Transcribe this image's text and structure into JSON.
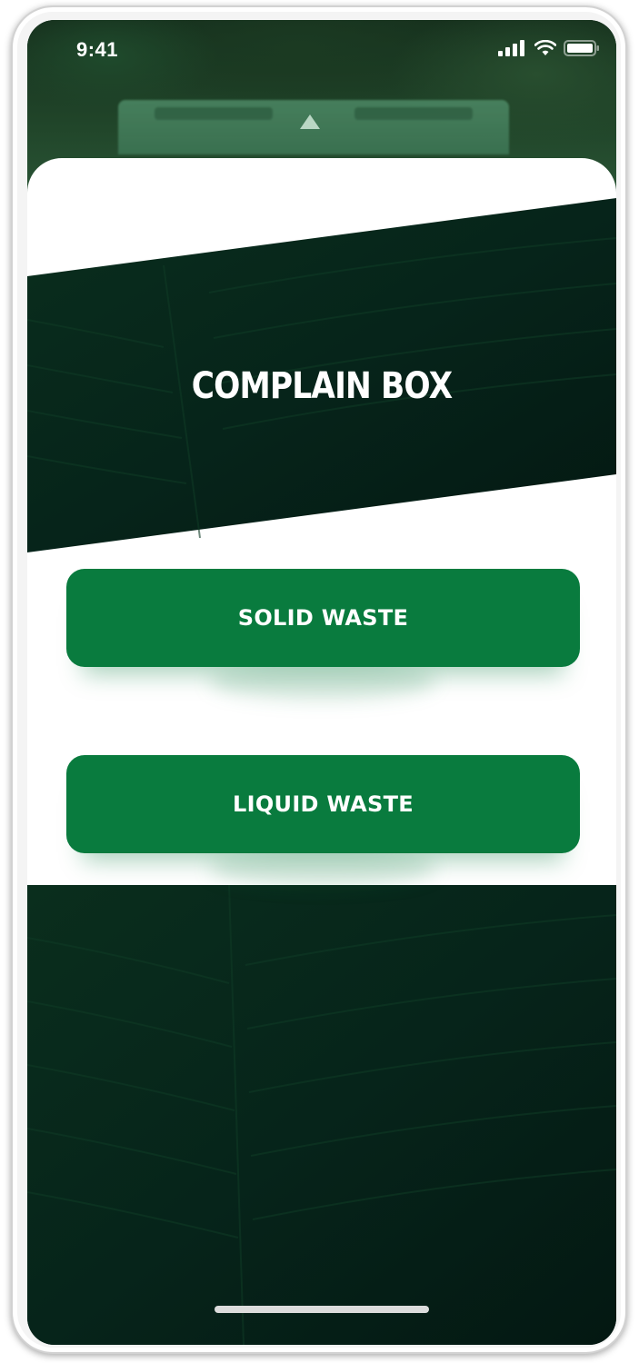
{
  "status_bar": {
    "time": "9:41",
    "signal_icon": "cellular-signal-icon",
    "wifi_icon": "wifi-icon",
    "battery_icon": "battery-icon"
  },
  "header": {
    "title": "COMPLAIN BOX"
  },
  "actions": {
    "solid_waste_label": "SOLID WASTE",
    "liquid_waste_label": "LIQUID WASTE"
  },
  "colors": {
    "primary_green": "#097b3e",
    "dark_background": "#062015",
    "card_background": "#ffffff",
    "title_text": "#ffffff"
  }
}
